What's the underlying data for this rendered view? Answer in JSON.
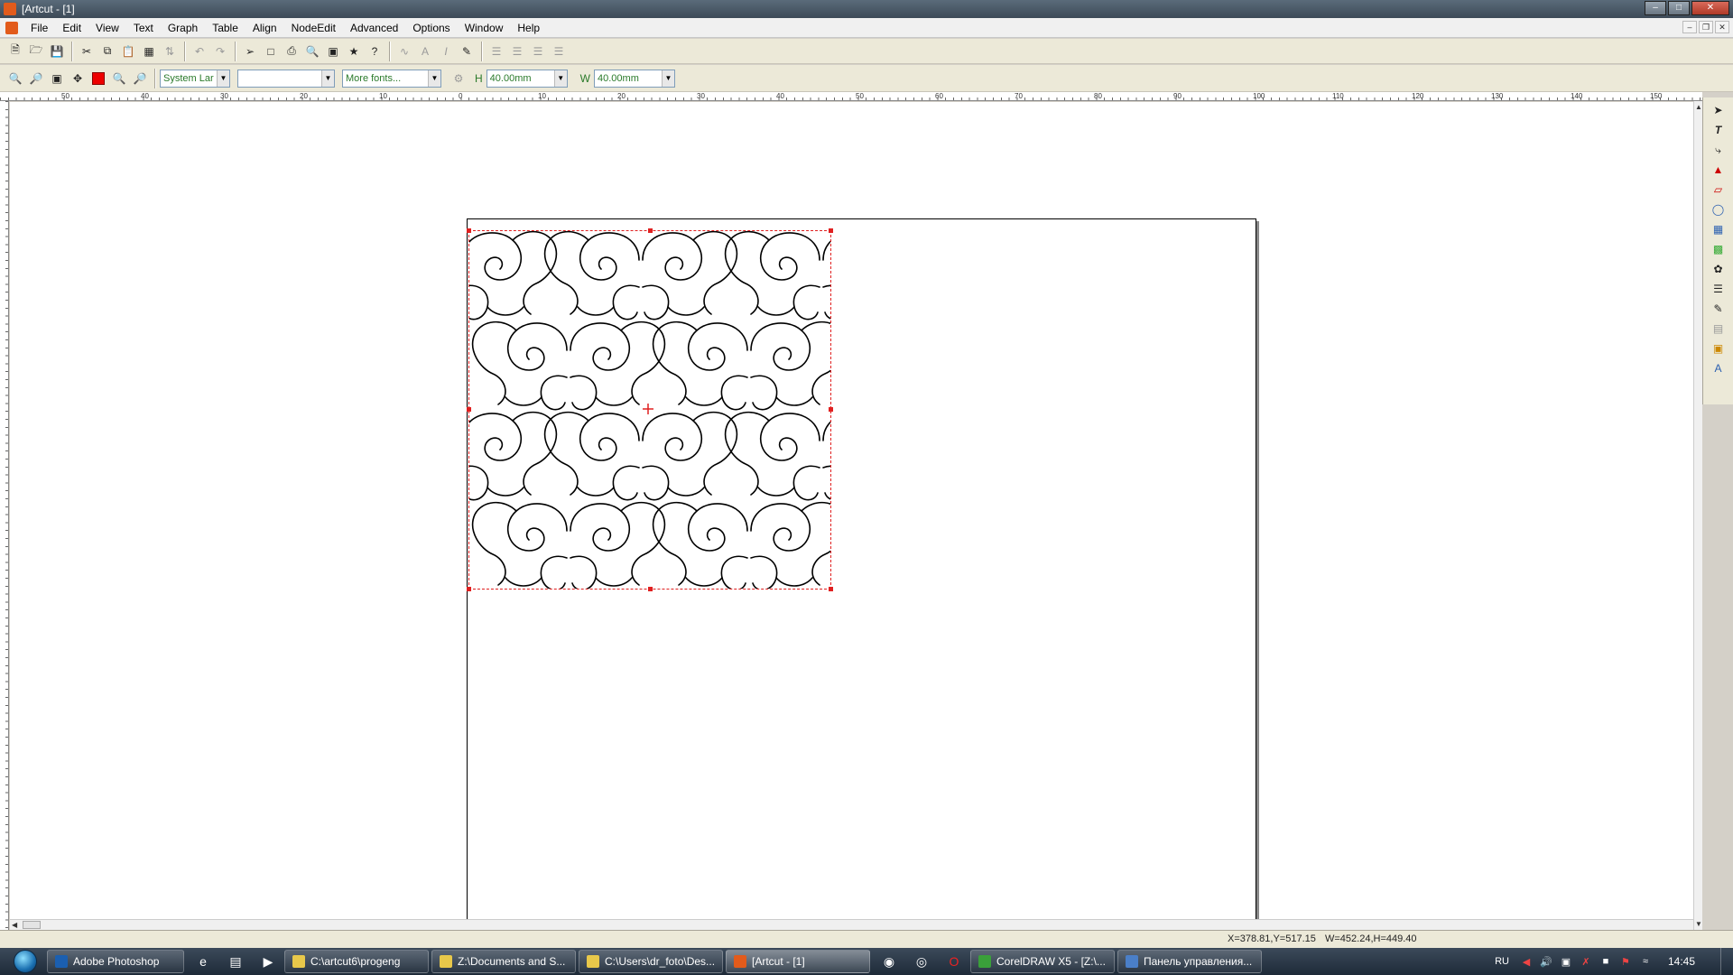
{
  "window": {
    "title": "[Artcut      - [1]",
    "controls": [
      "minimize",
      "maximize",
      "close"
    ]
  },
  "menu": [
    "File",
    "Edit",
    "View",
    "Text",
    "Graph",
    "Table",
    "Align",
    "NodeEdit",
    "Advanced",
    "Options",
    "Window",
    "Help"
  ],
  "toolbar1": {
    "groups": [
      [
        "new-icon",
        "open-icon",
        "save-icon"
      ],
      [
        "cut-icon",
        "copy-icon",
        "paste-icon",
        "paste-special-icon",
        "import-icon"
      ],
      [
        "undo-icon",
        "redo-icon"
      ],
      [
        "output-icon",
        "page-setup-icon",
        "print-icon",
        "print-preview-icon",
        "scan-icon",
        "tip-icon",
        "help-icon"
      ],
      [
        "text-path-icon",
        "text-frame-icon",
        "italic-icon",
        "edit-text-icon"
      ],
      [
        "align-left-icon",
        "align-center-icon",
        "align-right-icon",
        "align-justify-icon"
      ]
    ]
  },
  "toolbar2": {
    "zoom_tools": [
      "zoom-out-icon",
      "zoom-in-icon",
      "zoom-selection-icon",
      "pan-icon",
      "color-fill-icon",
      "zoom-page-icon",
      "zoom-all-icon"
    ],
    "font_language": "System Lar",
    "font_size": "",
    "font_name": "More fonts...",
    "height_label": "H",
    "height_value": "40.00mm",
    "width_label": "W",
    "width_value": "40.00mm"
  },
  "ruler": {
    "h_labels": [
      "50",
      "40",
      "30",
      "20",
      "10",
      "0",
      "10",
      "20",
      "30",
      "40",
      "50",
      "60",
      "70",
      "80",
      "90",
      "100",
      "110",
      "120",
      "130",
      "140",
      "150"
    ]
  },
  "palette_tools": [
    "pointer-icon",
    "text-tool-icon",
    "node-edit-icon",
    "fill-icon",
    "outline-icon",
    "shape-icon",
    "table-icon",
    "grid-icon",
    "weld-icon",
    "lines-icon",
    "contour-icon",
    "layer-icon",
    "frame-icon",
    "text-style-icon"
  ],
  "status": {
    "coords": "X=378.81,Y=517.15",
    "size": "W=452.24,H=449.40"
  },
  "taskbar": {
    "items": [
      {
        "label": "Adobe Photoshop",
        "color": "#1b5fb0",
        "active": false
      },
      {
        "label": "C:\\artcut6\\progeng",
        "color": "#e8c84a",
        "active": false
      },
      {
        "label": "Z:\\Documents and S...",
        "color": "#e8c84a",
        "active": false
      },
      {
        "label": "C:\\Users\\dr_foto\\Des...",
        "color": "#e8c84a",
        "active": false
      },
      {
        "label": "[Artcut      - [1]",
        "color": "#e25b1b",
        "active": true
      },
      {
        "label": "CorelDRAW X5 - [Z:\\...",
        "color": "#3aa03a",
        "active": false
      },
      {
        "label": "Панель управления...",
        "color": "#4a7fc8",
        "active": false
      }
    ],
    "lang": "RU",
    "clock": "14:45"
  }
}
